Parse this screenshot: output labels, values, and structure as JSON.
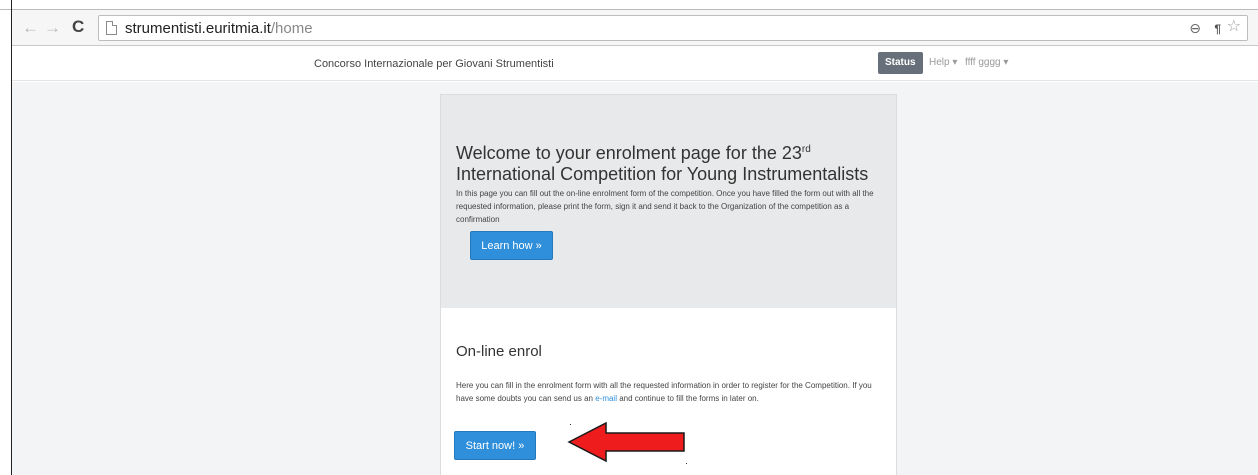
{
  "browser": {
    "url_host": "strumentisti.euritmia.it",
    "url_path": "/home",
    "back_icon": "←",
    "forward_icon": "→",
    "reload_icon": "C",
    "zoom_icon": "⊖",
    "translate_icon": "¶",
    "star_icon": "☆"
  },
  "navbar": {
    "brand": "Concorso Internazionale per Giovani Strumentisti",
    "status_label": "Status",
    "help_label": "Help ▾",
    "user_label": "ffff gggg ▾"
  },
  "hero": {
    "title_line1": "Welcome to your enrolment page for the 23",
    "title_sup": "rd",
    "title_line2": "International Competition for Young Instrumentalists",
    "text": "In this page you can fill out the on-line enrolment form of the competition. Once you have filled the form out with all the requested information, please print the form, sign it and send it back to the Organization of the competition as a confirmation",
    "button_label": "Learn how »"
  },
  "enrol": {
    "title": "On-line enrol",
    "text_before_link": "Here you can fill in the enrolment form with all the requested information in order to register for the Competition. If you have some doubts you can send us an ",
    "link_label": "e-mail",
    "text_after_link": " and continue to fill the forms in later on.",
    "button_label": "Start now! »"
  },
  "colors": {
    "accent_blue": "#2f8fdb",
    "status_gray": "#67707a",
    "arrow_red": "#ee1c1c"
  }
}
